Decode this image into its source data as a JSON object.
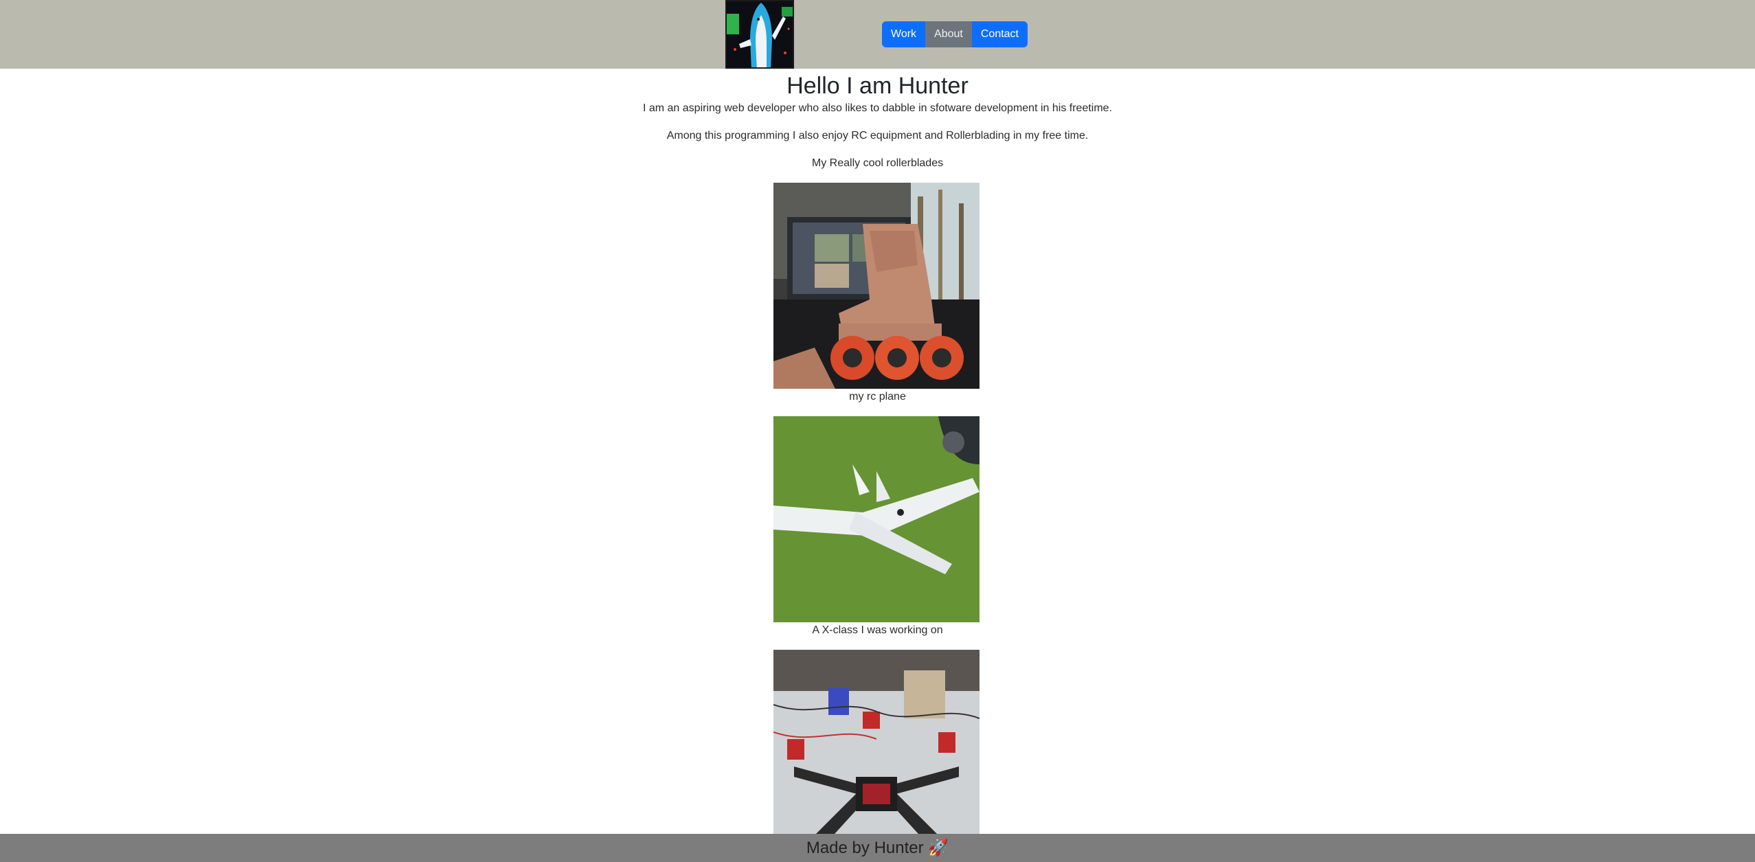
{
  "navbar": {
    "logo_icon": "shark-costume-avatar-icon",
    "buttons": [
      {
        "label": "Work",
        "active": false
      },
      {
        "label": "About",
        "active": true
      },
      {
        "label": "Contact",
        "active": false
      }
    ]
  },
  "main": {
    "heading": "Hello I am Hunter",
    "intro": "I am an aspiring web developer who also likes to dabble in sfotware development in his freetime.",
    "hobbies": "Among this programming I also enjoy RC equipment and Rollerblading in my free time.",
    "caption_rollerblades": "My Really cool rollerblades",
    "caption_plane": "my rc plane",
    "caption_xclass": "A X-class I was working on"
  },
  "footer": {
    "text": "Made by Hunter 🚀"
  },
  "colors": {
    "navbar_bg": "#bbbaaf",
    "primary": "#0d6efd",
    "active": "#6c757d",
    "footer_bg": "#7d7d7d"
  }
}
